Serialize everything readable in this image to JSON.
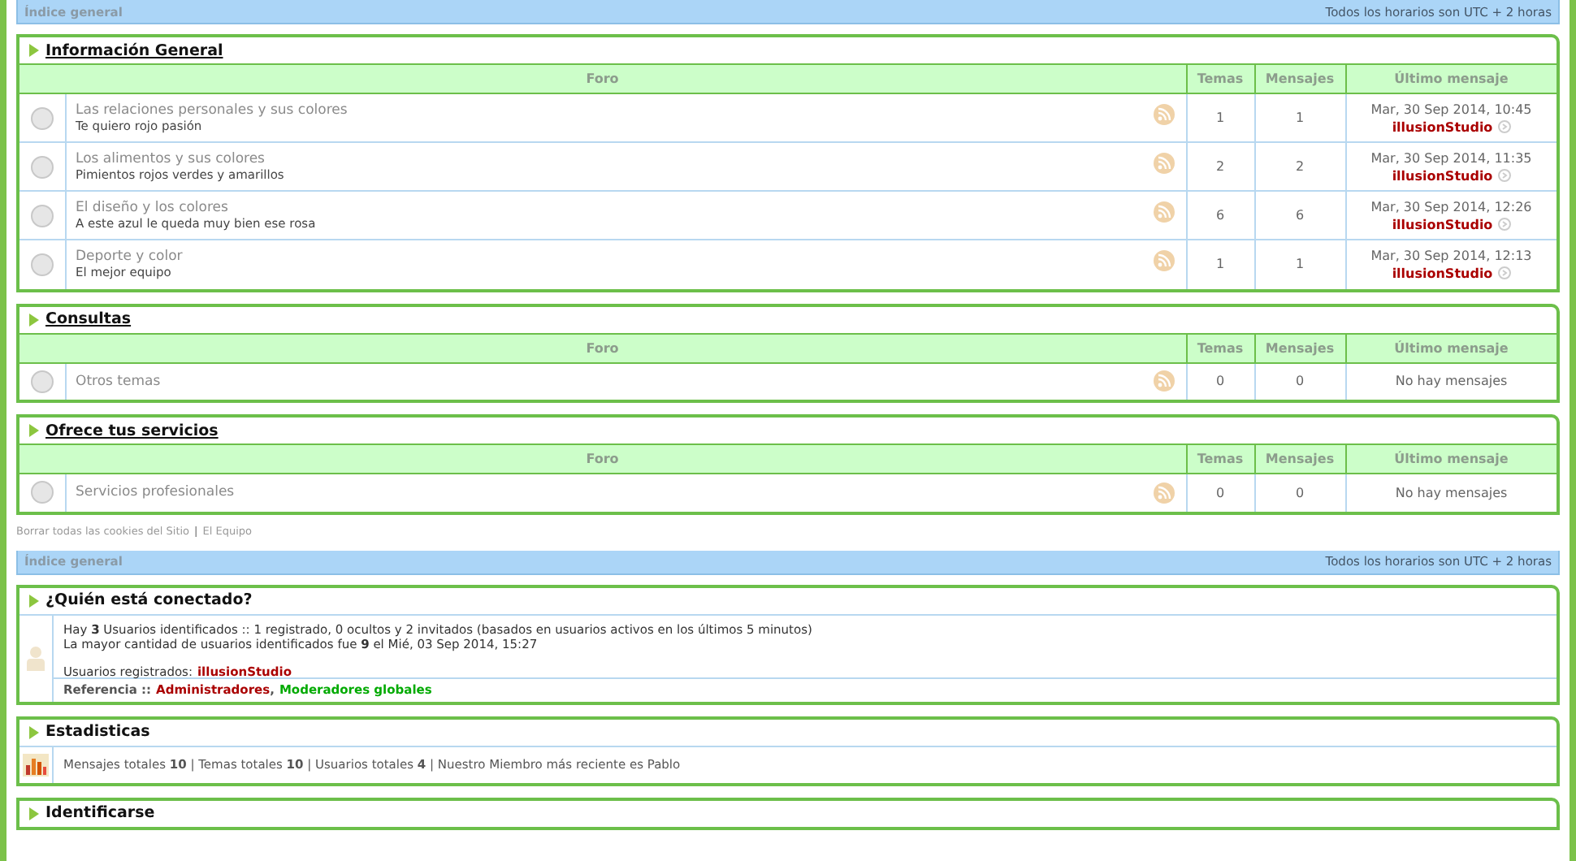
{
  "breadcrumbs": [
    {
      "link": "Índice general",
      "timezone": "Todos los horarios son UTC + 2 horas"
    },
    {
      "link": "Índice general",
      "timezone": "Todos los horarios son UTC + 2 horas"
    }
  ],
  "categories": [
    {
      "title": "Información General",
      "columns": [
        "Foro",
        "Temas",
        "Mensajes",
        "Último mensaje"
      ],
      "forums": [
        {
          "name": "Las relaciones personales y sus colores",
          "description": "Te quiero rojo pasión",
          "topics": "1",
          "posts": "1",
          "last_post": {
            "kind": "post",
            "date": "Mar, 30 Sep 2014, 10:45",
            "author": "illusionStudio"
          }
        },
        {
          "name": "Los alimentos y sus colores",
          "description": "Pimientos rojos verdes y amarillos",
          "topics": "2",
          "posts": "2",
          "last_post": {
            "kind": "post",
            "date": "Mar, 30 Sep 2014, 11:35",
            "author": "illusionStudio"
          }
        },
        {
          "name": "El diseño y los colores",
          "description": "A este azul le queda muy bien ese rosa",
          "topics": "6",
          "posts": "6",
          "last_post": {
            "kind": "post",
            "date": "Mar, 30 Sep 2014, 12:26",
            "author": "illusionStudio"
          }
        },
        {
          "name": "Deporte y color",
          "description": "El mejor equipo",
          "topics": "1",
          "posts": "1",
          "last_post": {
            "kind": "post",
            "date": "Mar, 30 Sep 2014, 12:13",
            "author": "illusionStudio"
          }
        }
      ]
    },
    {
      "title": "Consultas",
      "columns": [
        "Foro",
        "Temas",
        "Mensajes",
        "Último mensaje"
      ],
      "forums": [
        {
          "name": "Otros temas",
          "topics": "0",
          "posts": "0",
          "last_post": {
            "kind": "empty",
            "text": "No hay mensajes"
          }
        }
      ]
    },
    {
      "title": "Ofrece tus servicios",
      "columns": [
        "Foro",
        "Temas",
        "Mensajes",
        "Último mensaje"
      ],
      "forums": [
        {
          "name": "Servicios profesionales",
          "topics": "0",
          "posts": "0",
          "last_post": {
            "kind": "empty",
            "text": "No hay mensajes"
          }
        }
      ]
    }
  ],
  "footer_links": [
    "Borrar todas las cookies del Sitio",
    "El Equipo"
  ],
  "footer_separator": "|",
  "online": {
    "title": "¿Quién está conectado?",
    "lines": [
      "Hay **3** Usuarios identificados :: 1 registrado, 0 ocultos y 2 invitados (basados en usuarios activos en los últimos 5 minutos)",
      "La mayor cantidad de usuarios identificados fue **9** el Mié, 03 Sep 2014, 15:27"
    ],
    "registered_label": "Usuarios registrados:",
    "registered_users": [
      "illusionStudio"
    ],
    "legend_label": "Referencia ::",
    "legend_separator": ",",
    "legend": [
      {
        "name": "Administradores",
        "color": "#aa0000"
      },
      {
        "name": "Moderadores globales",
        "color": "#00aa00"
      }
    ]
  },
  "stats": {
    "title": "Estadisticas",
    "text": "Mensajes totales **10** | Temas totales **10** | Usuarios totales **4** | Nuestro Miembro más reciente es Pablo"
  },
  "login": {
    "title": "Identificarse"
  }
}
